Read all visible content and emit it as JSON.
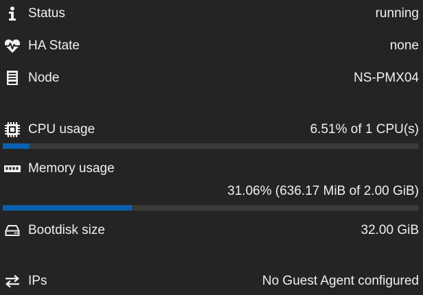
{
  "colors": {
    "background": "#242424",
    "text": "#f0f0f0",
    "bar_track": "#3a3a3a",
    "bar_fill": "#0a60b0"
  },
  "rows": {
    "status": {
      "icon": "info-icon",
      "label": "Status",
      "value": "running"
    },
    "ha_state": {
      "icon": "heartbeat-icon",
      "label": "HA State",
      "value": "none"
    },
    "node": {
      "icon": "server-icon",
      "label": "Node",
      "value": "NS-PMX04"
    },
    "cpu": {
      "icon": "cpu-icon",
      "label": "CPU usage",
      "value": "6.51% of 1 CPU(s)",
      "usage_fraction": 0.0651
    },
    "memory": {
      "icon": "memory-icon",
      "label": "Memory usage",
      "value": "31.06% (636.17 MiB of 2.00 GiB)",
      "usage_fraction": 0.3106
    },
    "bootdisk": {
      "icon": "hdd-icon",
      "label": "Bootdisk size",
      "value": "32.00 GiB"
    },
    "ips": {
      "icon": "exchange-icon",
      "label": "IPs",
      "value": "No Guest Agent configured"
    }
  }
}
